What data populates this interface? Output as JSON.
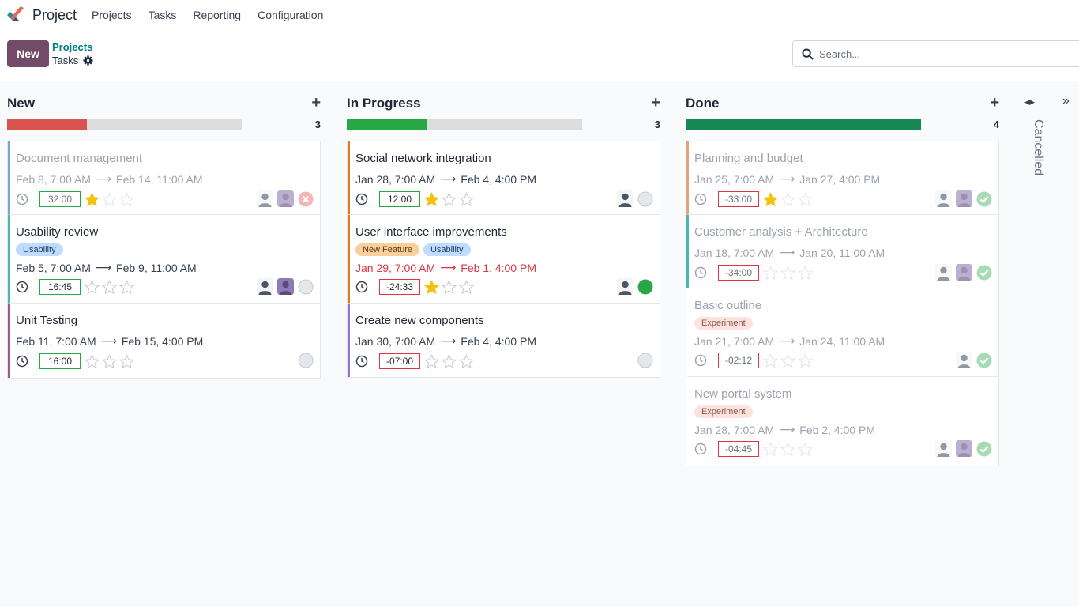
{
  "navbar": {
    "app_name": "Project",
    "menu": [
      "Projects",
      "Tasks",
      "Reporting",
      "Configuration"
    ]
  },
  "control": {
    "new_label": "New",
    "breadcrumb_parent": "Projects",
    "breadcrumb_current": "Tasks",
    "search_placeholder": "Search..."
  },
  "colors": {
    "brand": "#714b67",
    "link": "#017e84",
    "new_progress": "#d9534f",
    "in_progress_progress": "#28a745",
    "done_progress": "#198754"
  },
  "columns": [
    {
      "title": "New",
      "count": "3",
      "progress": 0.34,
      "cards": [
        {
          "title": "Document management",
          "tags": [],
          "start": "Feb 8, 7:00 AM",
          "end": "Feb 14, 11:00 AM",
          "time": "32:00",
          "stars": 1,
          "status": "blocked",
          "avatars": 2,
          "accent": "#7aa3d8",
          "faded": true,
          "overdue": false
        },
        {
          "title": "Usability review",
          "tags": [
            {
              "label": "Usability",
              "bg": "#bfdbfe",
              "fg": "#1e3a5f"
            }
          ],
          "start": "Feb 5, 7:00 AM",
          "end": "Feb 9, 11:00 AM",
          "time": "16:45",
          "stars": 0,
          "status": "normal",
          "avatars": 2,
          "accent": "#4db6ac",
          "faded": false,
          "overdue": false
        },
        {
          "title": "Unit Testing",
          "tags": [],
          "start": "Feb 11, 7:00 AM",
          "end": "Feb 15, 4:00 PM",
          "time": "16:00",
          "stars": 0,
          "status": "normal",
          "avatars": 0,
          "accent": "#a05a7f",
          "faded": false,
          "overdue": false
        }
      ]
    },
    {
      "title": "In Progress",
      "count": "3",
      "progress": 0.34,
      "cards": [
        {
          "title": "Social network integration",
          "tags": [],
          "start": "Jan 28, 7:00 AM",
          "end": "Feb 4, 4:00 PM",
          "time": "12:00",
          "stars": 1,
          "status": "normal",
          "avatars": 1,
          "accent": "#e07c24",
          "faded": false,
          "overdue": false
        },
        {
          "title": "User interface improvements",
          "tags": [
            {
              "label": "New Feature",
              "bg": "#fbcf9c",
              "fg": "#5c3a10"
            },
            {
              "label": "Usability",
              "bg": "#bfdbfe",
              "fg": "#1e3a5f"
            }
          ],
          "start": "Jan 29, 7:00 AM",
          "end": "Feb 1, 4:00 PM",
          "time": "-24:33",
          "stars": 1,
          "status": "done",
          "avatars": 1,
          "accent": "#e07c24",
          "faded": false,
          "overdue": true
        },
        {
          "title": "Create new components",
          "tags": [],
          "start": "Jan 30, 7:00 AM",
          "end": "Feb 4, 4:00 PM",
          "time": "-07:00",
          "stars": 0,
          "status": "normal",
          "avatars": 0,
          "accent": "#9b6bd6",
          "faded": false,
          "overdue": false
        }
      ]
    },
    {
      "title": "Done",
      "count": "4",
      "progress": 1.0,
      "cards": [
        {
          "title": "Planning and budget",
          "tags": [],
          "start": "Jan 25, 7:00 AM",
          "end": "Jan 27, 4:00 PM",
          "time": "-33:00",
          "stars": 1,
          "status": "check",
          "avatars": 2,
          "accent": "#e8a07e",
          "faded": true,
          "overdue": false
        },
        {
          "title": "Customer analysis + Architecture",
          "tags": [],
          "start": "Jan 18, 7:00 AM",
          "end": "Jan 20, 11:00 AM",
          "time": "-34:00",
          "stars": 0,
          "status": "check",
          "avatars": 2,
          "accent": "#4db6ac",
          "faded": true,
          "overdue": false
        },
        {
          "title": "Basic outline",
          "tags": [
            {
              "label": "Experiment",
              "bg": "#fde2dd",
              "fg": "#8a5a52"
            }
          ],
          "start": "Jan 21, 7:00 AM",
          "end": "Jan 24, 11:00 AM",
          "time": "-02:12",
          "stars": 0,
          "status": "check",
          "avatars": 1,
          "accent": "transparent",
          "faded": true,
          "overdue": false
        },
        {
          "title": "New portal system",
          "tags": [
            {
              "label": "Experiment",
              "bg": "#fde2dd",
              "fg": "#8a5a52"
            }
          ],
          "start": "Jan 28, 7:00 AM",
          "end": "Feb 2, 4:00 PM",
          "time": "-04:45",
          "stars": 0,
          "status": "check",
          "avatars": 2,
          "accent": "transparent",
          "faded": true,
          "overdue": false
        }
      ]
    }
  ],
  "folded_column": {
    "title": "Cancelled"
  }
}
